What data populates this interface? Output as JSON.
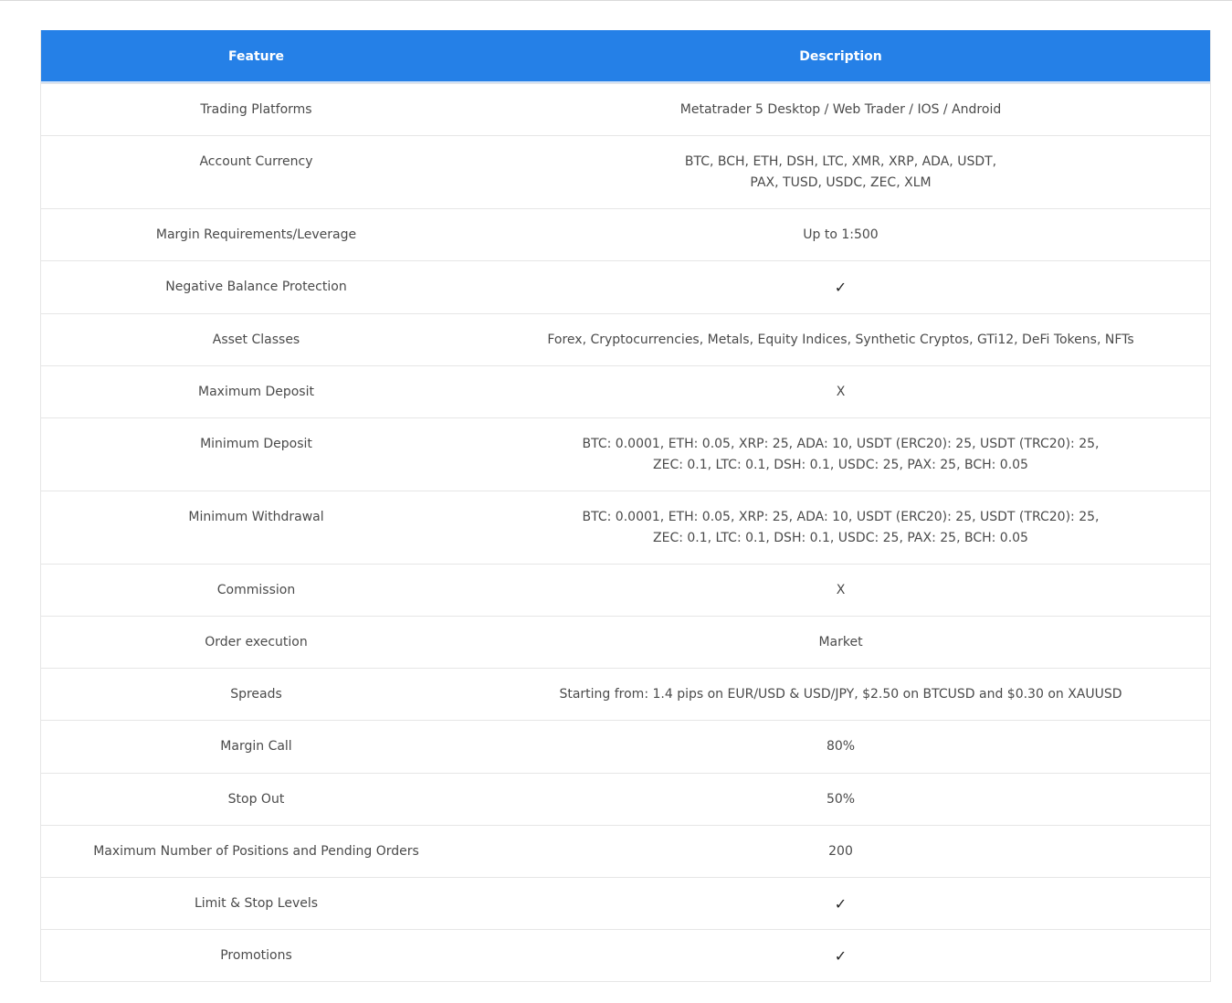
{
  "table": {
    "header": {
      "feature": "Feature",
      "description": "Description"
    },
    "rows": [
      {
        "feature": "Trading Platforms",
        "description": [
          "Metatrader 5 Desktop / Web Trader / IOS / Android"
        ]
      },
      {
        "feature": "Account Currency",
        "description": [
          "BTC, BCH, ETH, DSH, LTC, XMR, XRP, ADA, USDT,",
          "PAX, TUSD, USDC, ZEC, XLM"
        ]
      },
      {
        "feature": "Margin Requirements/Leverage",
        "description": [
          "Up to 1:500"
        ]
      },
      {
        "feature": "Negative Balance Protection",
        "description": [
          "✓"
        ]
      },
      {
        "feature": "Asset Classes",
        "description": [
          "Forex, Cryptocurrencies, Metals, Equity Indices, Synthetic Cryptos, GTi12, DeFi Tokens, NFTs"
        ]
      },
      {
        "feature": "Maximum Deposit",
        "description": [
          "X"
        ]
      },
      {
        "feature": "Minimum Deposit",
        "description": [
          "BTC: 0.0001, ETH: 0.05, XRP: 25, ADA: 10, USDT (ERC20): 25, USDT (TRC20): 25,",
          "ZEC: 0.1, LTC: 0.1, DSH: 0.1, USDC: 25, PAX: 25, BCH: 0.05"
        ]
      },
      {
        "feature": "Minimum Withdrawal",
        "description": [
          "BTC: 0.0001, ETH: 0.05, XRP: 25, ADA: 10, USDT (ERC20): 25, USDT (TRC20): 25,",
          "ZEC: 0.1, LTC: 0.1, DSH: 0.1, USDC: 25, PAX: 25, BCH: 0.05"
        ]
      },
      {
        "feature": "Commission",
        "description": [
          "X"
        ]
      },
      {
        "feature": "Order execution",
        "description": [
          "Market"
        ]
      },
      {
        "feature": "Spreads",
        "description": [
          "Starting from: 1.4 pips on EUR/USD & USD/JPY, $2.50 on BTCUSD and $0.30 on XAUUSD"
        ]
      },
      {
        "feature": "Margin Call",
        "description": [
          "80%"
        ]
      },
      {
        "feature": "Stop Out",
        "description": [
          "50%"
        ]
      },
      {
        "feature": "Maximum Number of Positions and Pending Orders",
        "description": [
          "200"
        ]
      },
      {
        "feature": "Limit & Stop Levels",
        "description": [
          "✓"
        ]
      },
      {
        "feature": "Promotions",
        "description": [
          "✓"
        ]
      }
    ]
  },
  "colors": {
    "header_bg": "#2580e7",
    "header_text": "#ffffff",
    "cell_text": "#4a4a4a",
    "border": "#e6e6e6"
  }
}
